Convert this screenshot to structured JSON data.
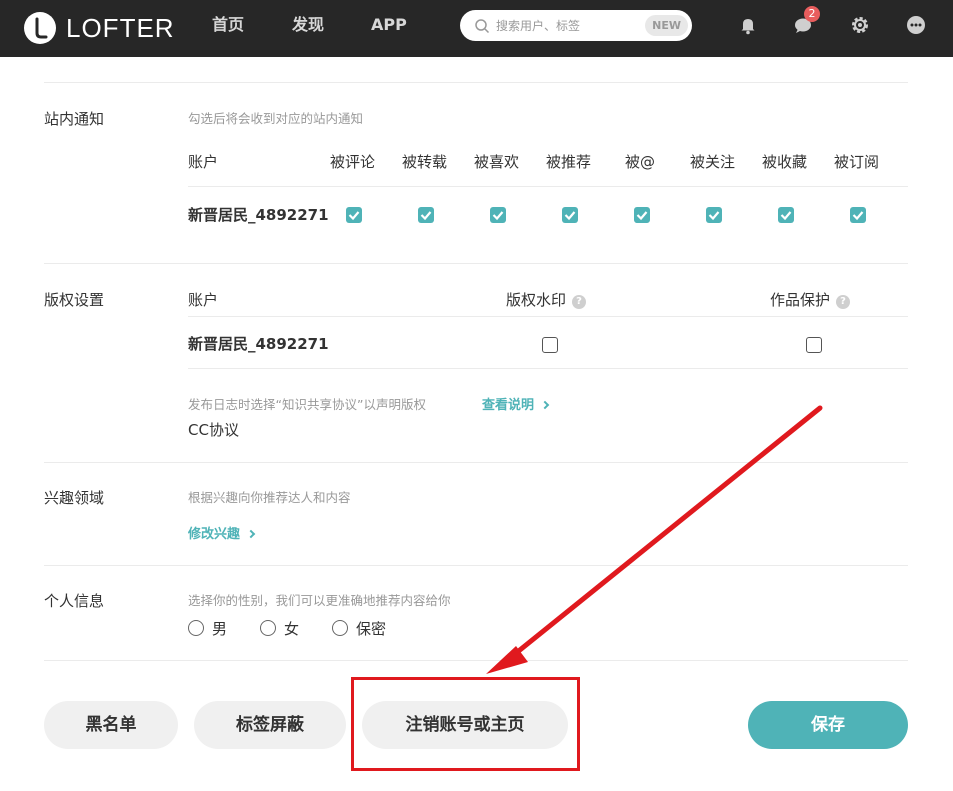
{
  "header": {
    "logo_text": "LOFTER",
    "nav": [
      "首页",
      "发现",
      "APP"
    ],
    "search_placeholder": "搜索用户、标签",
    "search_badge": "NEW",
    "message_count": "2"
  },
  "notifications": {
    "title": "站内通知",
    "hint": "勾选后将会收到对应的站内通知",
    "columns": [
      "账户",
      "被评论",
      "被转载",
      "被喜欢",
      "被推荐",
      "被@",
      "被关注",
      "被收藏",
      "被订阅"
    ],
    "account": "新晋居民_4892271"
  },
  "copyright": {
    "title": "版权设置",
    "col_account": "账户",
    "col_watermark": "版权水印",
    "col_protect": "作品保护",
    "account": "新晋居民_4892271",
    "cc_hint": "发布日志时选择“知识共享协议”以声明版权",
    "cc_link": "查看说明",
    "cc_label": "CC协议"
  },
  "interests": {
    "title": "兴趣领域",
    "hint": "根据兴趣向你推荐达人和内容",
    "link": "修改兴趣"
  },
  "personal": {
    "title": "个人信息",
    "hint": "选择你的性别，我们可以更准确地推荐内容给你",
    "options": [
      "男",
      "女",
      "保密"
    ]
  },
  "actions": {
    "blacklist": "黑名单",
    "tag_block": "标签屏蔽",
    "deactivate": "注销账号或主页",
    "save": "保存"
  },
  "colors": {
    "accent": "#4fb3b7",
    "annotation": "#e0191e",
    "topbar": "#272727"
  }
}
